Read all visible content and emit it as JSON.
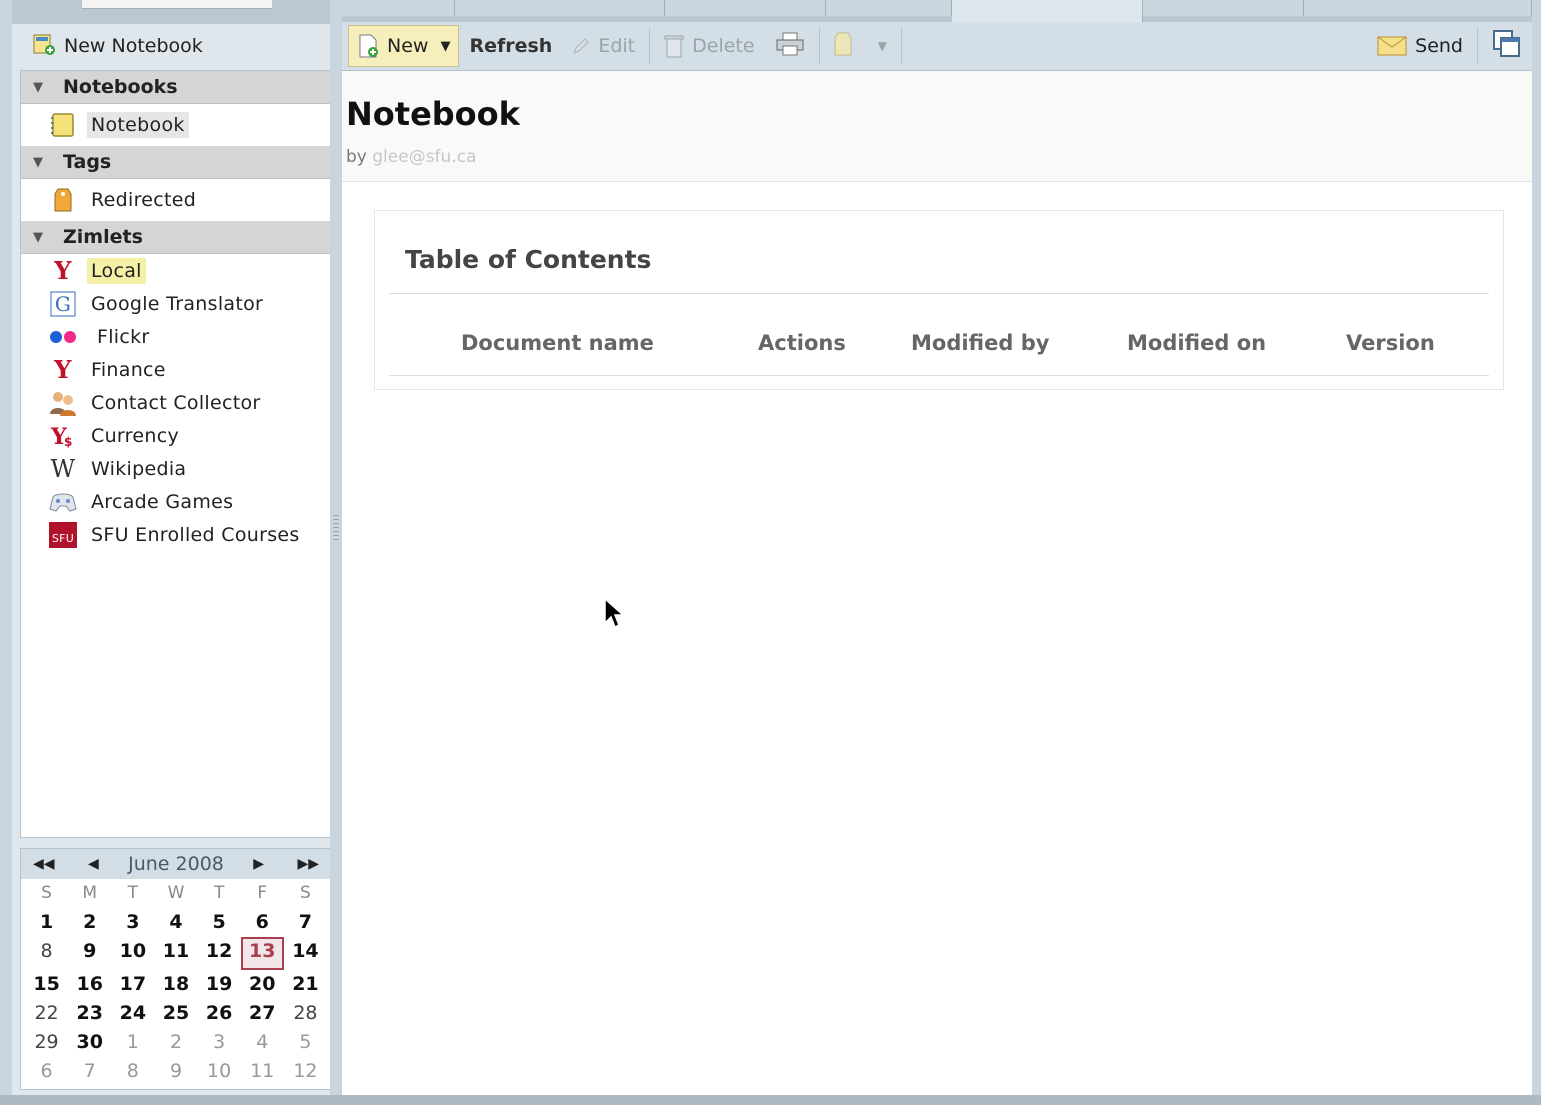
{
  "sidebar": {
    "new_notebook_label": "New Notebook",
    "sections": {
      "notebooks": {
        "title": "Notebooks",
        "items": [
          {
            "label": "Notebook",
            "icon": "notebook-icon"
          }
        ]
      },
      "tags": {
        "title": "Tags",
        "items": [
          {
            "label": "Redirected",
            "icon": "tag-icon"
          }
        ]
      },
      "zimlets": {
        "title": "Zimlets",
        "items": [
          {
            "label": "Local",
            "icon": "yahoo-local-icon"
          },
          {
            "label": "Google Translator",
            "icon": "google-icon"
          },
          {
            "label": "Flickr",
            "icon": "flickr-icon"
          },
          {
            "label": "Finance",
            "icon": "yahoo-finance-icon"
          },
          {
            "label": "Contact Collector",
            "icon": "contacts-icon"
          },
          {
            "label": "Currency",
            "icon": "yahoo-currency-icon"
          },
          {
            "label": "Wikipedia",
            "icon": "wikipedia-icon"
          },
          {
            "label": "Arcade Games",
            "icon": "gamepad-icon"
          },
          {
            "label": "SFU Enrolled Courses",
            "icon": "sfu-icon"
          }
        ]
      }
    }
  },
  "calendar": {
    "month_label": "June 2008",
    "dow": [
      "S",
      "M",
      "T",
      "W",
      "T",
      "F",
      "S"
    ],
    "weeks": [
      [
        "1",
        "2",
        "3",
        "4",
        "5",
        "6",
        "7"
      ],
      [
        "8",
        "9",
        "10",
        "11",
        "12",
        "13",
        "14"
      ],
      [
        "15",
        "16",
        "17",
        "18",
        "19",
        "20",
        "21"
      ],
      [
        "22",
        "23",
        "24",
        "25",
        "26",
        "27",
        "28"
      ],
      [
        "29",
        "30",
        "1",
        "2",
        "3",
        "4",
        "5"
      ],
      [
        "6",
        "7",
        "8",
        "9",
        "10",
        "11",
        "12"
      ]
    ],
    "today": "13"
  },
  "toolbar": {
    "new_label": "New",
    "refresh_label": "Refresh",
    "edit_label": "Edit",
    "delete_label": "Delete",
    "send_label": "Send"
  },
  "main": {
    "title": "Notebook",
    "by_prefix": "by",
    "owner_email": "glee@sfu.ca",
    "toc": {
      "title": "Table of Contents",
      "columns": [
        "Document name",
        "Actions",
        "Modified by",
        "Modified on",
        "Version"
      ]
    }
  },
  "colors": {
    "today_border": "#a94050",
    "new_button_bg": "#f6efbb",
    "highlight": "#f5f0a8"
  }
}
